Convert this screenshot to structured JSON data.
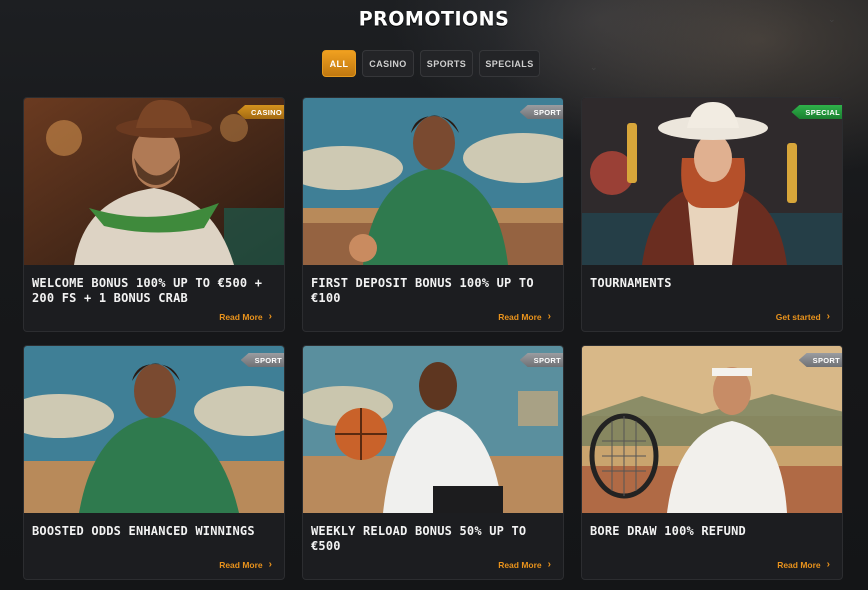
{
  "page": {
    "title": "PROMOTIONS"
  },
  "filters": [
    {
      "label": "ALL",
      "active": true
    },
    {
      "label": "CASINO",
      "active": false
    },
    {
      "label": "SPORTS",
      "active": false
    },
    {
      "label": "SPECIALS",
      "active": false
    }
  ],
  "cards": [
    {
      "tag": "CASINO",
      "title": "WELCOME BONUS 100% UP TO €500 + 200 FS + 1 BONUS CRAB",
      "cta": "Read More"
    },
    {
      "tag": "SPORT",
      "title": "FIRST DEPOSIT BONUS 100% UP TO €100",
      "cta": "Read More"
    },
    {
      "tag": "SPECIAL",
      "title": "TOURNAMENTS",
      "cta": "Get started"
    },
    {
      "tag": "SPORT",
      "title": "BOOSTED ODDS ENHANCED WINNINGS",
      "cta": "Read More"
    },
    {
      "tag": "SPORT",
      "title": "WEEKLY RELOAD BONUS 50% UP TO €500",
      "cta": "Read More"
    },
    {
      "tag": "SPORT",
      "title": "BORE DRAW 100% REFUND",
      "cta": "Read More"
    }
  ],
  "colors": {
    "accent": "#e8921c",
    "casino": "#c7861a",
    "sport": "#8a8c90",
    "special": "#27a040"
  }
}
